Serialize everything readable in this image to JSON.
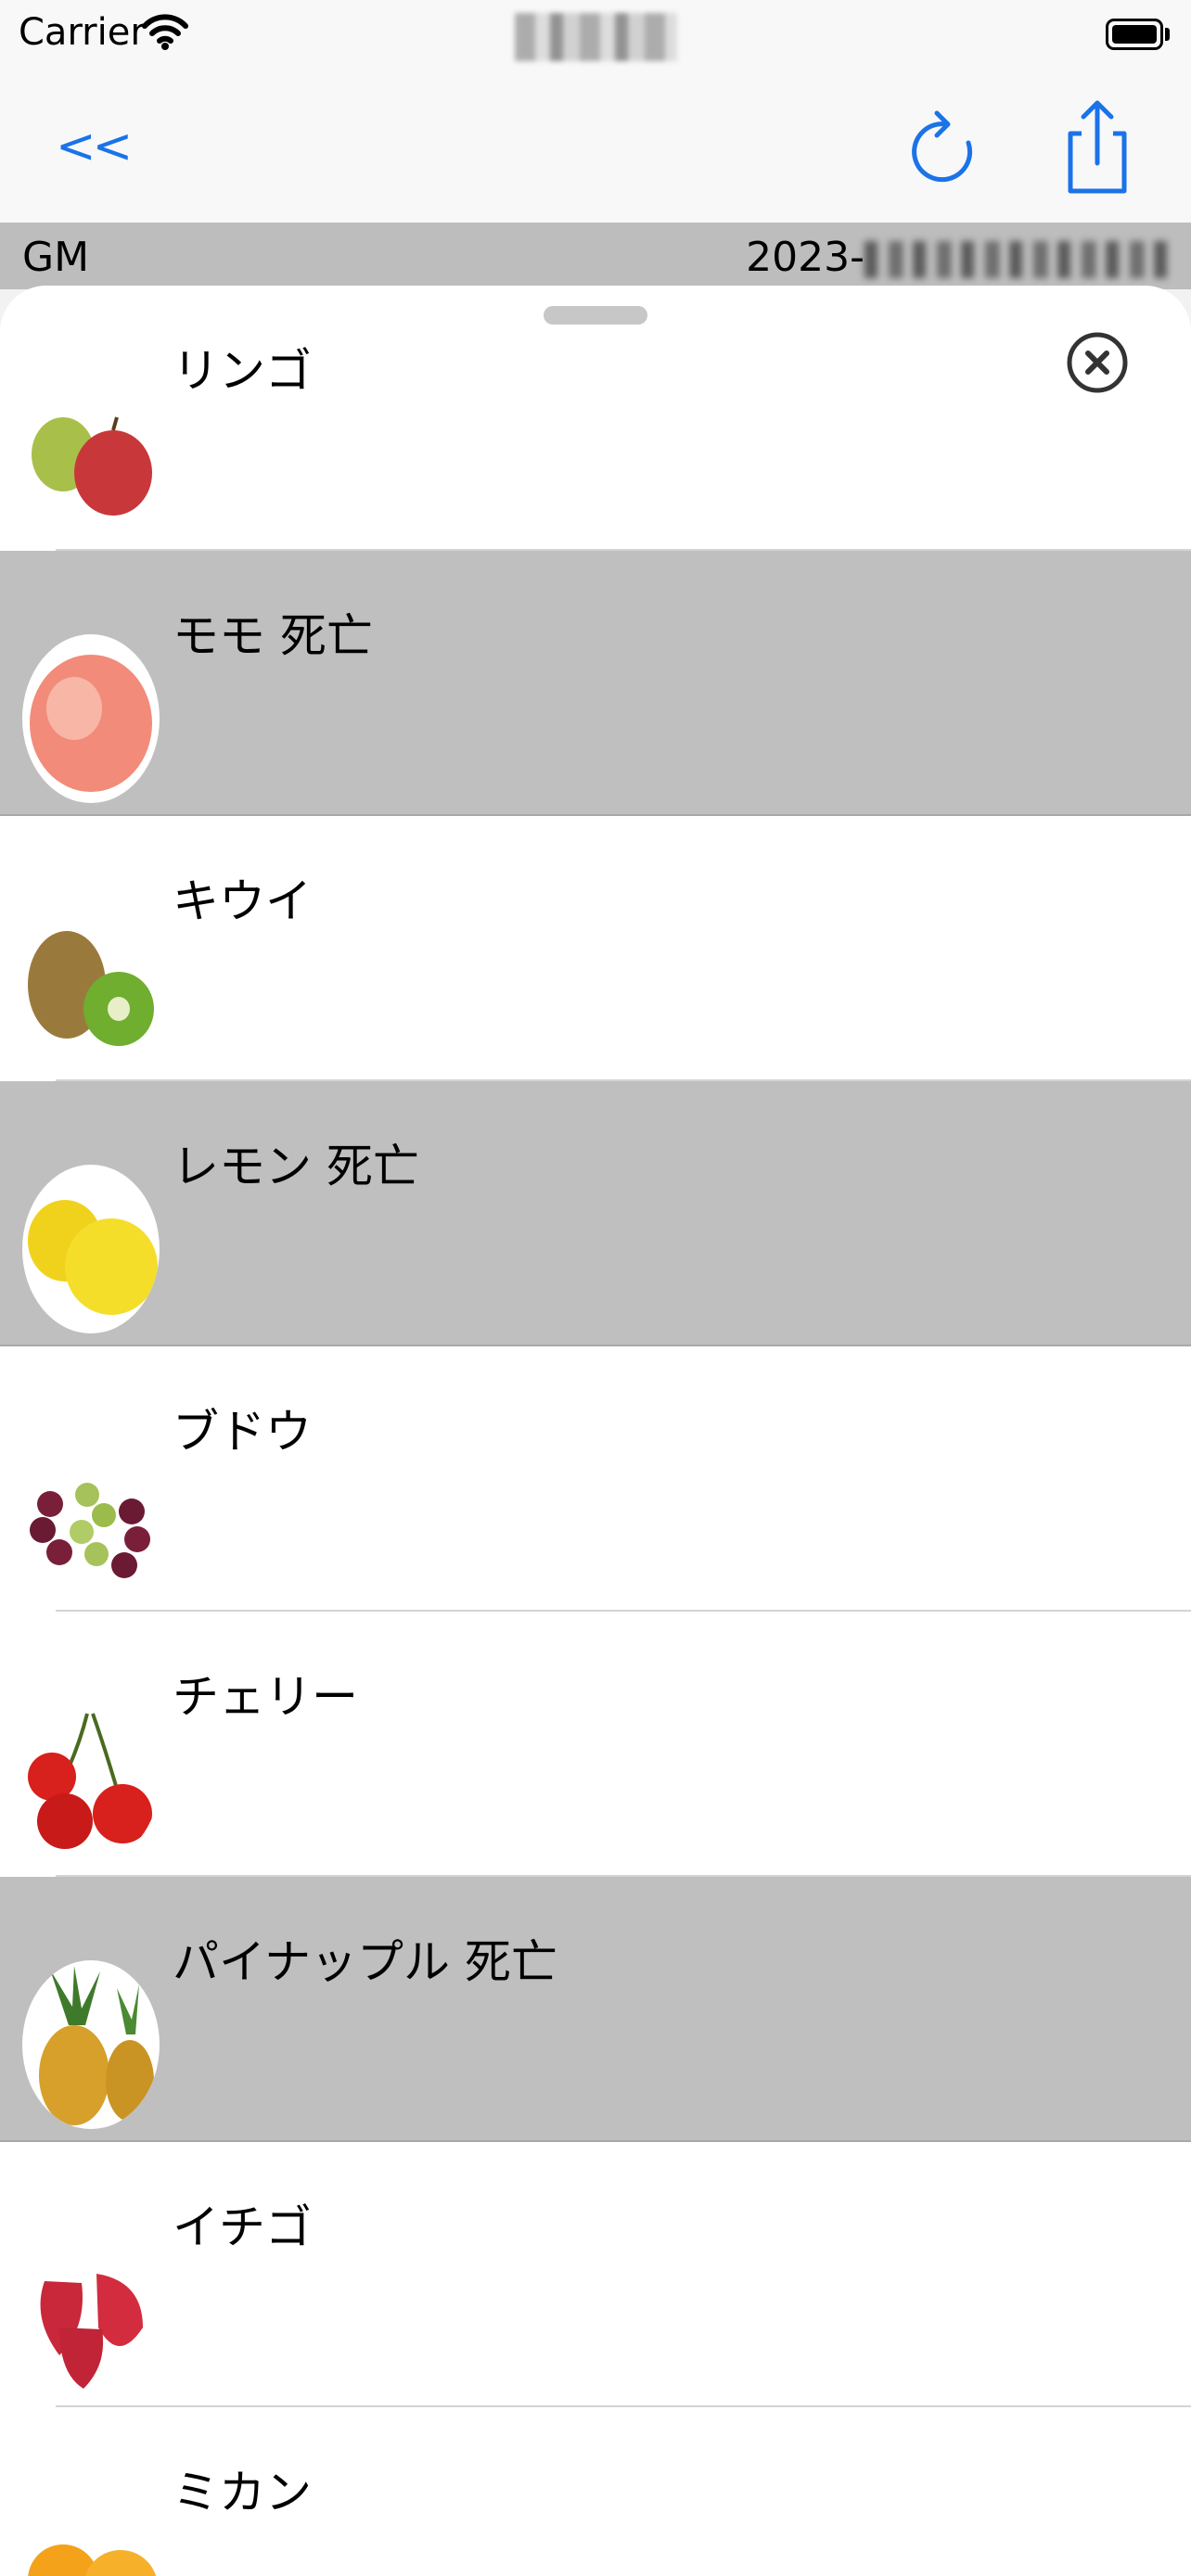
{
  "status_bar": {
    "carrier": "Carrier"
  },
  "nav": {
    "back_label": "<<"
  },
  "info": {
    "left": "GM",
    "right_prefix": "2023-"
  },
  "colors": {
    "accent": "#1a73e8",
    "dead_row": "#bfbfbf",
    "info_strip": "#bdbdbd"
  },
  "icons": {
    "refresh": "refresh-icon",
    "share": "share-icon",
    "close": "close-circle-icon"
  },
  "fruits": [
    {
      "label": "リンゴ",
      "dead": false,
      "image": "apple-image"
    },
    {
      "label": "モモ 死亡",
      "dead": true,
      "image": "peach-image"
    },
    {
      "label": "キウイ",
      "dead": false,
      "image": "kiwi-image"
    },
    {
      "label": "レモン 死亡",
      "dead": true,
      "image": "lemon-image"
    },
    {
      "label": "ブドウ",
      "dead": false,
      "image": "grape-image"
    },
    {
      "label": "チェリー",
      "dead": false,
      "image": "cherry-image"
    },
    {
      "label": "パイナップル 死亡",
      "dead": true,
      "image": "pineapple-image"
    },
    {
      "label": "イチゴ",
      "dead": false,
      "image": "strawberry-image"
    },
    {
      "label": "ミカン",
      "dead": false,
      "image": "mandarin-image"
    }
  ]
}
